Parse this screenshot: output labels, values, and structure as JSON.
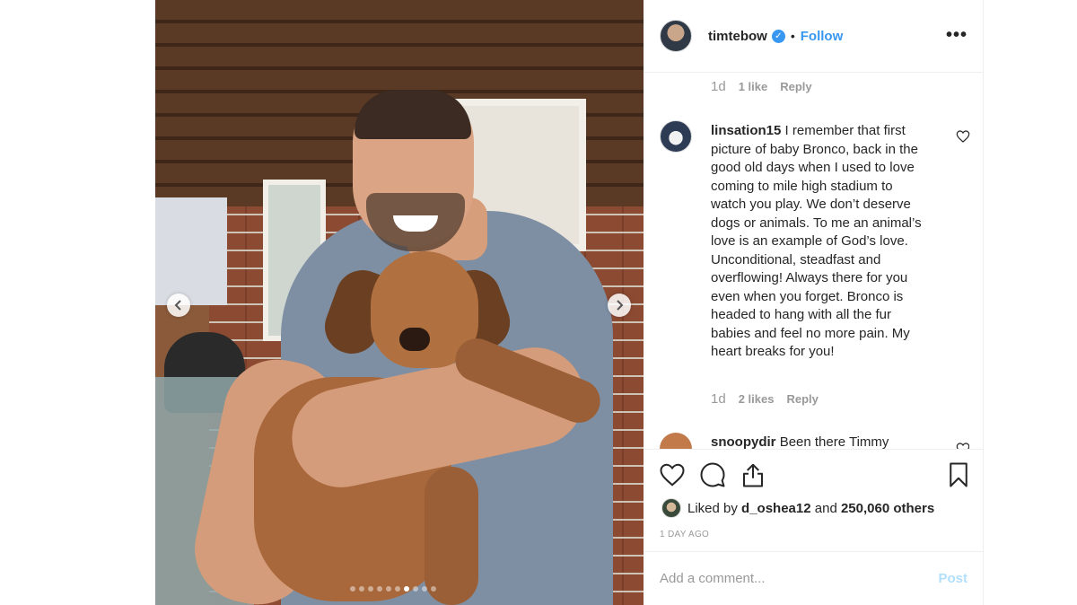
{
  "post": {
    "carousel_dots": 10,
    "active_dot": 6,
    "prev_icon": "chevron-left-icon",
    "next_icon": "chevron-right-icon"
  },
  "header": {
    "username": "timtebow",
    "verified_icon": "verified-badge-icon",
    "separator": "•",
    "follow_label": "Follow",
    "more_label": "•••"
  },
  "comments": {
    "previous_meta": {
      "time": "1d",
      "likes": "1 like",
      "reply": "Reply"
    },
    "main": {
      "username": "linsation15",
      "text": "I remember that first picture of baby Bronco, back in the good old days when I used to love coming to mile high stadium to watch you play. We don’t deserve dogs or animals. To me an animal’s love is an example of God’s love. Unconditional, steadfast and overflowing! Always there for you even when you forget. Bronco is headed to hang with all the fur babies and feel no more pain. My heart breaks for you!",
      "time": "1d",
      "likes": "2 likes",
      "reply": "Reply"
    },
    "next": {
      "username": "snoopydir",
      "text": "Been there Timmy"
    }
  },
  "actions": {
    "like_icon": "heart-icon",
    "comment_icon": "comment-icon",
    "share_icon": "share-icon",
    "save_icon": "bookmark-icon",
    "liked_by_prefix": "Liked by",
    "liked_by_user": "d_oshea12",
    "liked_by_and": "and",
    "liked_by_others": "250,060 others",
    "time_ago": "1 DAY AGO"
  },
  "composer": {
    "placeholder": "Add a comment...",
    "post_label": "Post"
  },
  "colors": {
    "accent": "#3897f0",
    "post_disabled": "#b2dffc",
    "muted": "#999999"
  }
}
